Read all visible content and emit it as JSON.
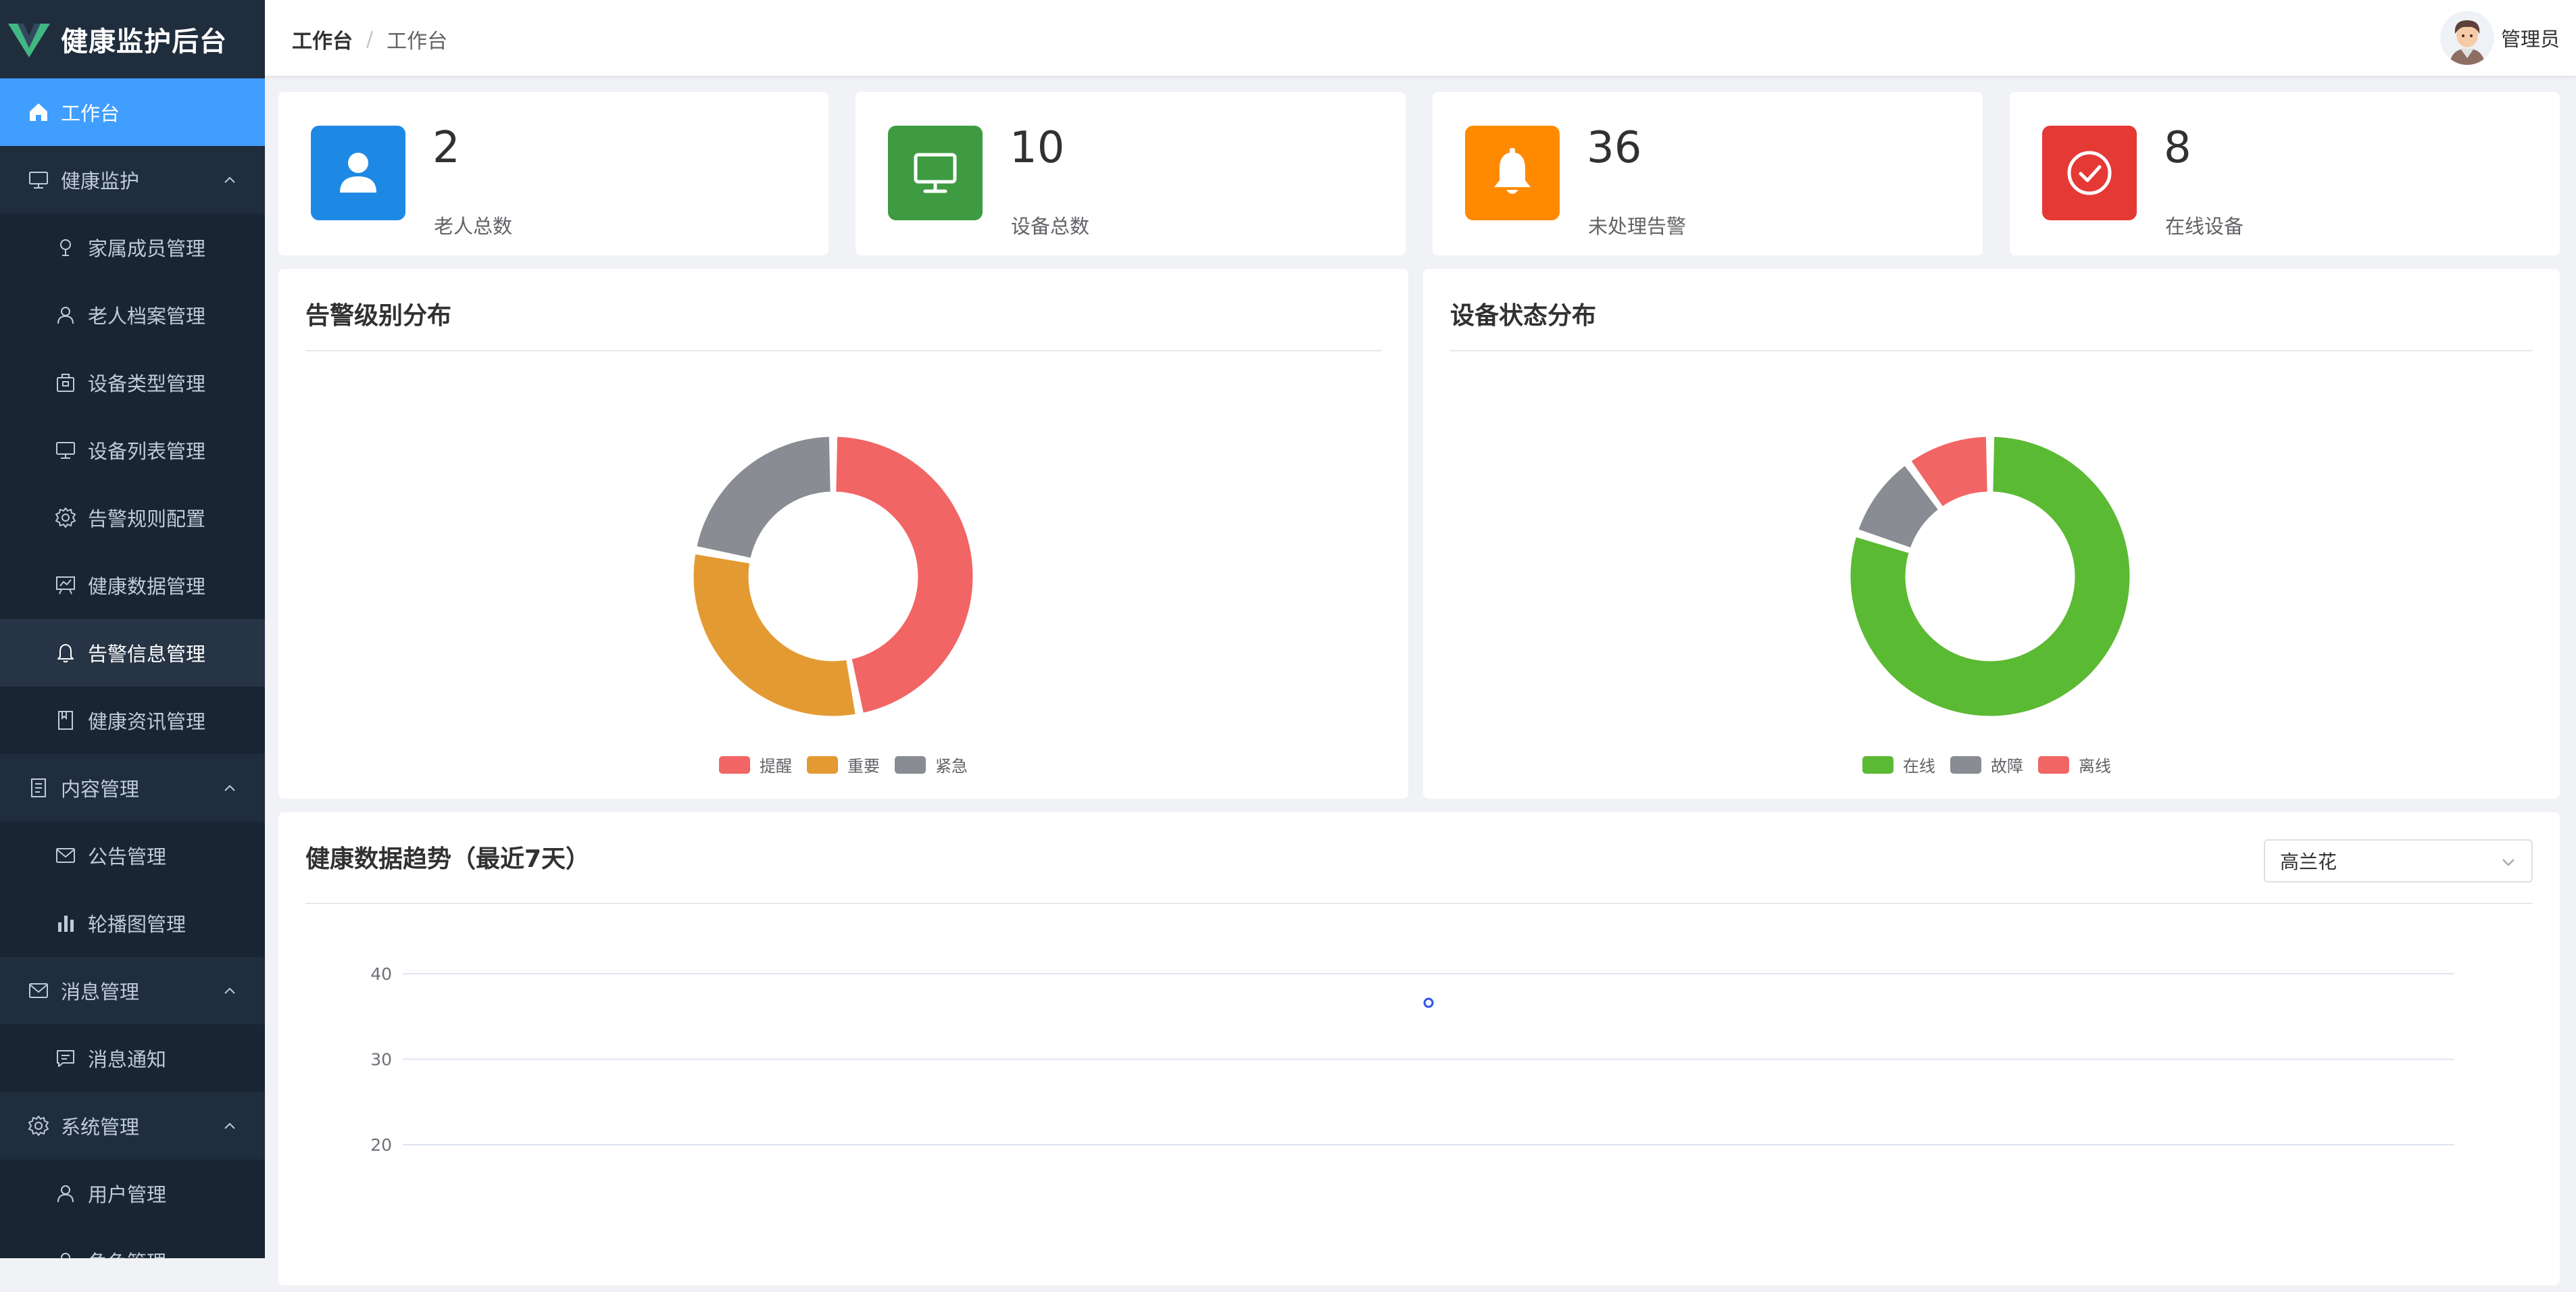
{
  "app": {
    "title": "健康监护后台"
  },
  "sidebar": {
    "items": [
      {
        "label": "工作台",
        "icon": "home-icon",
        "level": "top",
        "state": "active"
      },
      {
        "label": "健康监护",
        "icon": "monitor-icon",
        "level": "top",
        "state": "expanded"
      },
      {
        "label": "家属成员管理",
        "icon": "pin-icon",
        "level": "sub"
      },
      {
        "label": "老人档案管理",
        "icon": "user-icon",
        "level": "sub"
      },
      {
        "label": "设备类型管理",
        "icon": "box-icon",
        "level": "sub"
      },
      {
        "label": "设备列表管理",
        "icon": "monitor-icon",
        "level": "sub"
      },
      {
        "label": "告警规则配置",
        "icon": "gear-icon",
        "level": "sub"
      },
      {
        "label": "健康数据管理",
        "icon": "presentation-icon",
        "level": "sub"
      },
      {
        "label": "告警信息管理",
        "icon": "bell-icon",
        "level": "sub",
        "state": "hover"
      },
      {
        "label": "健康资讯管理",
        "icon": "bookmark-icon",
        "level": "sub"
      },
      {
        "label": "内容管理",
        "icon": "document-icon",
        "level": "top",
        "state": "expanded"
      },
      {
        "label": "公告管理",
        "icon": "message-icon",
        "level": "sub"
      },
      {
        "label": "轮播图管理",
        "icon": "bar-chart-icon",
        "level": "sub"
      },
      {
        "label": "消息管理",
        "icon": "message-icon",
        "level": "top",
        "state": "expanded"
      },
      {
        "label": "消息通知",
        "icon": "chat-icon",
        "level": "sub"
      },
      {
        "label": "系统管理",
        "icon": "gear-icon",
        "level": "top",
        "state": "expanded"
      },
      {
        "label": "用户管理",
        "icon": "user-icon",
        "level": "sub"
      },
      {
        "label": "角色管理",
        "icon": "user-icon",
        "level": "sub"
      }
    ]
  },
  "header": {
    "breadcrumb": [
      "工作台",
      "工作台"
    ],
    "breadcrumb_sep": "/",
    "user_name": "管理员"
  },
  "stats": [
    {
      "value": "2",
      "label": "老人总数",
      "color": "#1e88e5",
      "icon": "user-icon"
    },
    {
      "value": "10",
      "label": "设备总数",
      "color": "#3e9b41",
      "icon": "monitor-icon"
    },
    {
      "value": "36",
      "label": "未处理告警",
      "color": "#ff8a00",
      "icon": "bell-icon"
    },
    {
      "value": "8",
      "label": "在线设备",
      "color": "#e53935",
      "icon": "check-circle-icon"
    }
  ],
  "alarm_panel": {
    "title": "告警级别分布"
  },
  "device_panel": {
    "title": "设备状态分布"
  },
  "trend_panel": {
    "title": "健康数据趋势（最近7天）",
    "select_value": "高兰花"
  },
  "chart_data": [
    {
      "type": "pie",
      "title": "告警级别分布",
      "donut": true,
      "legend": "bottom",
      "categories": [
        "提醒",
        "重要",
        "紧急"
      ],
      "values": [
        47,
        31,
        22
      ],
      "colors": [
        "#f26565",
        "#e49a33",
        "#898c92"
      ]
    },
    {
      "type": "pie",
      "title": "设备状态分布",
      "donut": true,
      "legend": "bottom",
      "categories": [
        "在线",
        "故障",
        "离线"
      ],
      "values": [
        80,
        10,
        10
      ],
      "colors": [
        "#5bba33",
        "#898c92",
        "#f26565"
      ]
    },
    {
      "type": "line",
      "title": "健康数据趋势（最近7天）",
      "yticks": [
        20,
        30,
        40
      ],
      "grid": true,
      "series": [
        {
          "points": [
            {
              "x": 0.5,
              "y": 36.6
            }
          ],
          "color": "#2f54eb"
        }
      ]
    }
  ]
}
